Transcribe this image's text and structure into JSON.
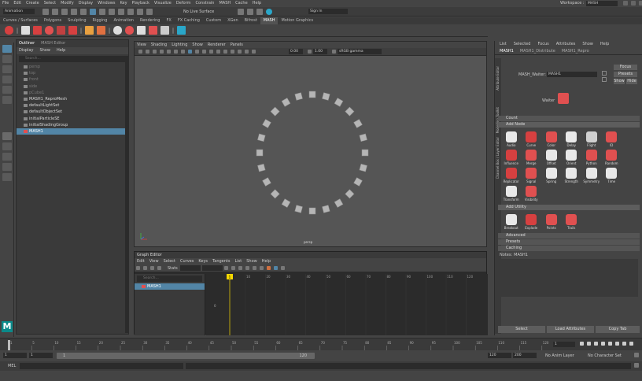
{
  "menubar": {
    "items": [
      "File",
      "Edit",
      "Create",
      "Select",
      "Modify",
      "Display",
      "Windows",
      "Key",
      "Playback",
      "Visualize",
      "Deform",
      "Constrain",
      "MASH",
      "Cache",
      "Help"
    ],
    "workspace_label": "Workspace :",
    "workspace_value": "MASH"
  },
  "status_line": {
    "mode": "Animation",
    "live_surface": "No Live Surface",
    "sign_in": "Sign In"
  },
  "shelf_tabs": [
    "Curves / Surfaces",
    "Polygons",
    "Sculpting",
    "Rigging",
    "Animation",
    "Rendering",
    "FX",
    "FX Caching",
    "Custom",
    "XGen",
    "Bifrost",
    "MASH",
    "Motion Graphics"
  ],
  "shelf_active": "MASH",
  "outliner": {
    "tabs": [
      "Outliner",
      "MASH Editor"
    ],
    "menu": [
      "Display",
      "Show",
      "Help"
    ],
    "search_placeholder": "Search...",
    "items": [
      {
        "label": "persp",
        "dim": true
      },
      {
        "label": "top",
        "dim": true
      },
      {
        "label": "front",
        "dim": true
      },
      {
        "label": "side",
        "dim": true
      },
      {
        "label": "pCube1",
        "dim": true
      },
      {
        "label": "MASH1_ReproMesh",
        "dim": false
      },
      {
        "label": "defaultLightSet",
        "dim": false
      },
      {
        "label": "defaultObjectSet",
        "dim": false
      },
      {
        "label": "initialParticleSE",
        "dim": false
      },
      {
        "label": "initialShadingGroup",
        "dim": false
      },
      {
        "label": "MASH1",
        "dim": false,
        "selected": true
      }
    ]
  },
  "viewport": {
    "menu": [
      "View",
      "Shading",
      "Lighting",
      "Show",
      "Renderer",
      "Panels"
    ],
    "field1": "0.00",
    "field2": "1.00",
    "color_space": "sRGB gamma",
    "camera_label": "persp"
  },
  "graph_editor": {
    "title": "Graph Editor",
    "menu": [
      "Edit",
      "View",
      "Select",
      "Curves",
      "Keys",
      "Tangents",
      "List",
      "Show",
      "Help"
    ],
    "stats_label": "Stats",
    "search_placeholder": "Search...",
    "item": "MASH1",
    "ruler": [
      "10",
      "20",
      "30",
      "40",
      "50",
      "60",
      "70",
      "80",
      "90",
      "100",
      "110",
      "120"
    ],
    "current_frame": "1",
    "y_value": "0"
  },
  "attribute_editor": {
    "menu": [
      "List",
      "Selected",
      "Focus",
      "Attributes",
      "Show",
      "Help"
    ],
    "tabs": [
      "MASH1",
      "MASH1_Distribute",
      "MASH1_Repro"
    ],
    "node_label": "MASH_Waiter:",
    "node_value": "MASH1",
    "buttons": [
      "Focus",
      "Presets",
      "Show",
      "Hide"
    ],
    "waiter_label": "Waiter",
    "sections": {
      "count": "Count",
      "add_node": "Add Node",
      "add_utility": "Add Utility",
      "advanced": "Advanced",
      "presets": "Presets",
      "caching": "Caching"
    },
    "nodes": [
      {
        "label": "Audio",
        "color": "#e8e8e8"
      },
      {
        "label": "Curve",
        "color": "#d64040"
      },
      {
        "label": "Color",
        "color": "#e05050"
      },
      {
        "label": "Delay",
        "color": "#e8e8e8"
      },
      {
        "label": "Flight",
        "color": "#cfcfcf"
      },
      {
        "label": "ID",
        "color": "#e05050"
      },
      {
        "label": "Influence",
        "color": "#d64040"
      },
      {
        "label": "Merge",
        "color": "#e05050"
      },
      {
        "label": "Offset",
        "color": "#e8e8e8"
      },
      {
        "label": "Orient",
        "color": "#e8e8e8"
      },
      {
        "label": "Python",
        "color": "#e05050"
      },
      {
        "label": "Random",
        "color": "#e05050"
      },
      {
        "label": "Replicator",
        "color": "#d64040"
      },
      {
        "label": "Signal",
        "color": "#e05050"
      },
      {
        "label": "Spring",
        "color": "#e8e8e8"
      },
      {
        "label": "Strength",
        "color": "#e8e8e8"
      },
      {
        "label": "Symmetry",
        "color": "#e8e8e8"
      },
      {
        "label": "Time",
        "color": "#e8e8e8"
      },
      {
        "label": "Transform",
        "color": "#e8e8e8"
      },
      {
        "label": "Visibility",
        "color": "#e05050"
      }
    ],
    "utilities": [
      {
        "label": "Breakout",
        "color": "#e8e8e8"
      },
      {
        "label": "Explode",
        "color": "#d64040"
      },
      {
        "label": "Points",
        "color": "#e05050"
      },
      {
        "label": "Trails",
        "color": "#e05050"
      }
    ],
    "notes_label": "Notes:",
    "notes_value": "MASH1",
    "bottom_buttons": [
      "Select",
      "Load Attributes",
      "Copy Tab"
    ],
    "side_tabs": [
      "Attribute Editor",
      "Modelling Toolkit",
      "Channel Box / Layer Editor"
    ]
  },
  "timeline": {
    "ticks": [
      "1",
      "5",
      "10",
      "15",
      "20",
      "25",
      "30",
      "35",
      "40",
      "45",
      "50",
      "55",
      "60",
      "65",
      "70",
      "75",
      "80",
      "85",
      "90",
      "95",
      "100",
      "105",
      "110",
      "115",
      "120"
    ],
    "current": "1"
  },
  "range": {
    "start": "1",
    "start2": "1",
    "inner_start": "1",
    "inner_end": "120",
    "end1": "120",
    "end2": "200",
    "anim_layer": "No Anim Layer",
    "char_set": "No Character Set"
  },
  "command_line": {
    "label": "MEL"
  },
  "colors": {
    "selection": "#5285a6",
    "mash_red": "#e05050",
    "timeline_marker": "#f5d800"
  }
}
